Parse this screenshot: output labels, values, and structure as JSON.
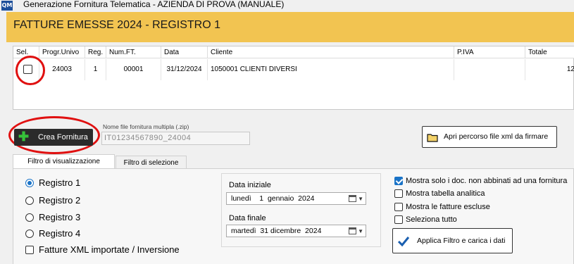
{
  "window": {
    "app_icon": "QM",
    "title": "Generazione Fornitura Telematica - AZIENDA DI PROVA (MANUALE)"
  },
  "header": {
    "title": "FATTURE EMESSE 2024 - REGISTRO 1",
    "accent": "#f2c451"
  },
  "grid": {
    "columns": [
      "Sel.",
      "Progr.Univo",
      "Reg.",
      "Num.FT.",
      "Data",
      "Cliente",
      "P.IVA",
      "Totale"
    ],
    "rows": [
      {
        "selected": false,
        "progr": "24003",
        "reg": "1",
        "num": "00001",
        "data": "31/12/2024",
        "cliente": "1050001 CLIENTI DIVERSI",
        "piva": "",
        "totale": "12"
      }
    ]
  },
  "toolbar": {
    "crea_label": "Crea Fornitura",
    "zip_label": "Nome file fornitura multipla (.zip)",
    "zip_value": "IT01234567890_24004",
    "apri_label": "Apri percorso file xml da firmare"
  },
  "tabs": [
    {
      "label": "Filtro di visualizzazione",
      "active": true
    },
    {
      "label": "Filtro di selezione",
      "active": false
    }
  ],
  "filters": {
    "registri": [
      {
        "label": "Registro 1",
        "selected": true
      },
      {
        "label": "Registro 2",
        "selected": false
      },
      {
        "label": "Registro 3",
        "selected": false
      },
      {
        "label": "Registro 4",
        "selected": false
      }
    ],
    "xml_label": "Fatture XML importate / Inversione",
    "xml_checked": false,
    "data_iniziale_label": "Data iniziale",
    "data_iniziale_value": "lunedì    1  gennaio  2024",
    "data_finale_label": "Data finale",
    "data_finale_value": "martedì  31 dicembre  2024",
    "options": [
      {
        "label": "Mostra solo i doc. non abbinati ad una fornitura",
        "checked": true
      },
      {
        "label": "Mostra tabella analitica",
        "checked": false
      },
      {
        "label": "Mostra le fatture escluse",
        "checked": false
      },
      {
        "label": "Seleziona tutto",
        "checked": false
      }
    ],
    "applica_label": "Applica Filtro e carica i dati"
  },
  "colors": {
    "highlight_ring": "#e01010",
    "selection_blue": "#1a73c7",
    "button_dark": "#2b2b2b",
    "plus_green": "#36c23a"
  }
}
